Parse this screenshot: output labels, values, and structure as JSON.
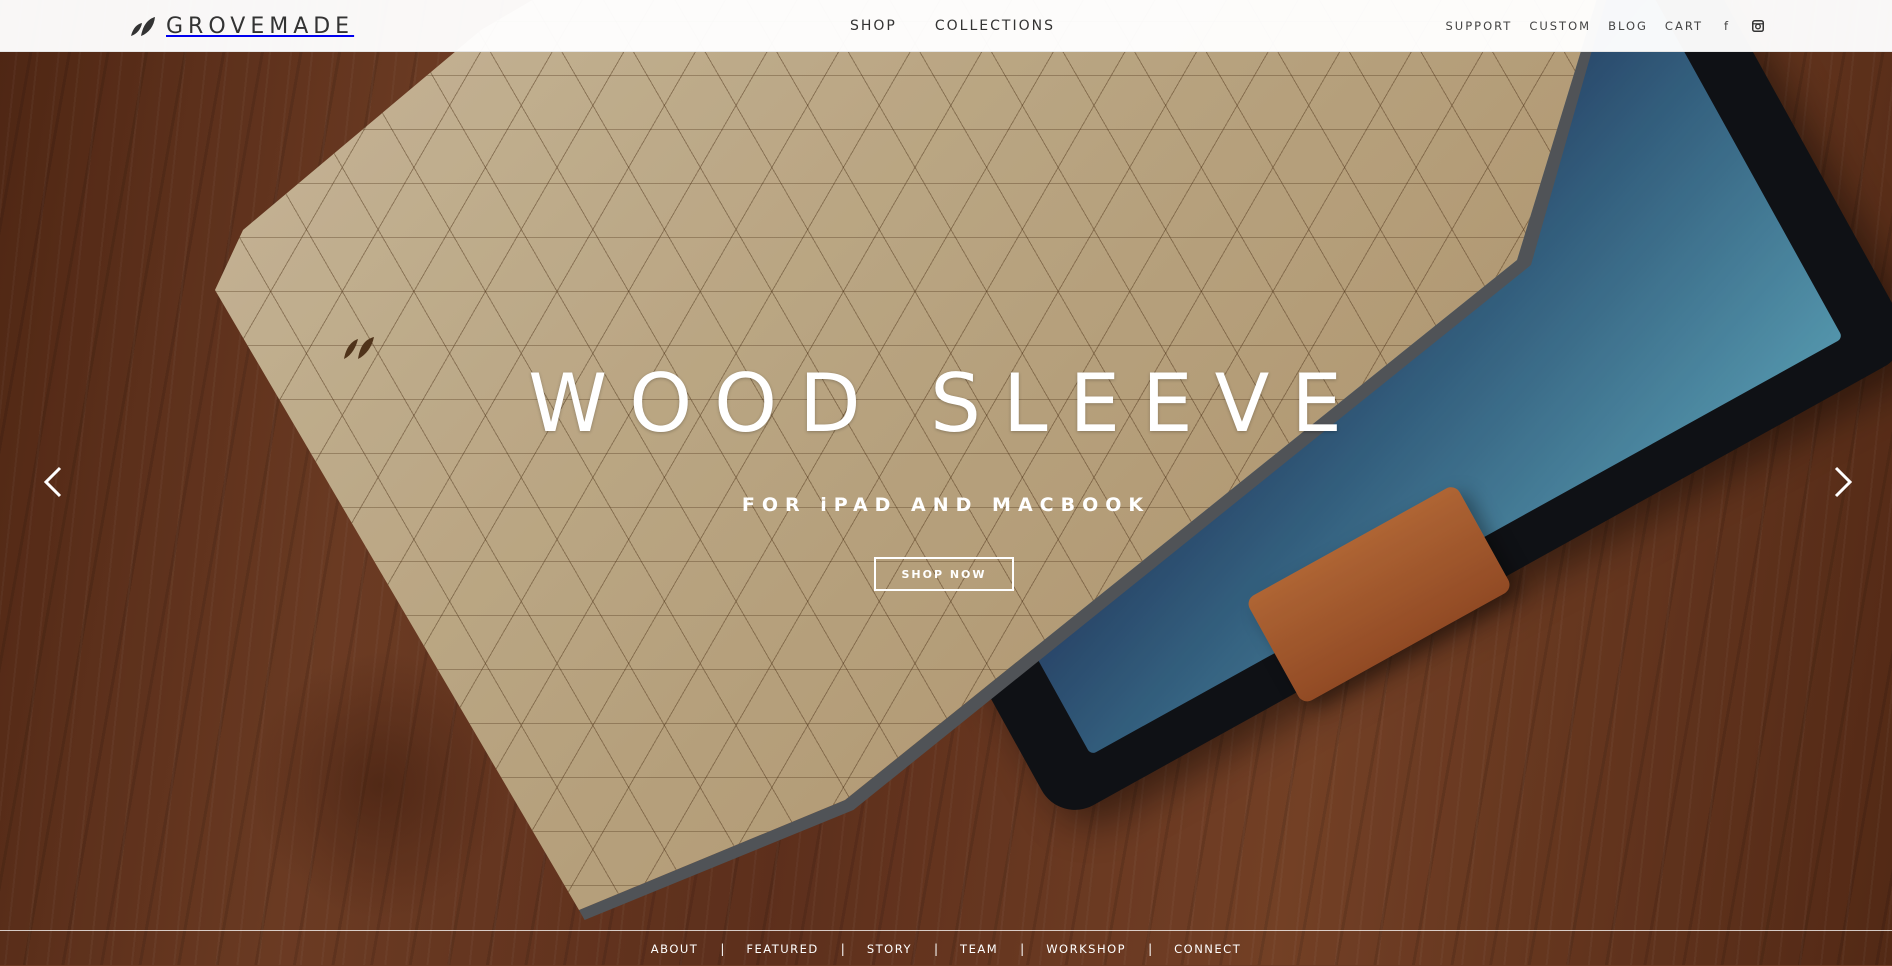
{
  "brand": {
    "name": "GROVEMADE",
    "logo_icon": "leaf-logo-icon"
  },
  "main_nav": [
    {
      "label": "SHOP"
    },
    {
      "label": "COLLECTIONS"
    }
  ],
  "util_nav": [
    {
      "label": "SUPPORT"
    },
    {
      "label": "CUSTOM"
    },
    {
      "label": "BLOG"
    },
    {
      "label": "CART"
    }
  ],
  "social": [
    {
      "icon": "facebook-icon",
      "glyph": "f"
    },
    {
      "icon": "instagram-icon",
      "glyph": "◙"
    }
  ],
  "hero": {
    "title": "WOOD SLEEVE",
    "subtitle": "FOR iPAD AND MACBOOK",
    "cta_label": "SHOP NOW",
    "prev_icon": "chevron-left-icon",
    "next_icon": "chevron-right-icon"
  },
  "footer_nav": [
    {
      "label": "ABOUT"
    },
    {
      "label": "FEATURED"
    },
    {
      "label": "STORY"
    },
    {
      "label": "TEAM"
    },
    {
      "label": "WORKSHOP"
    },
    {
      "label": "CONNECT"
    }
  ],
  "footer_separator": "|",
  "colors": {
    "nav_bg": "#f7f7f7",
    "nav_text": "#333333",
    "hero_text": "#ffffff",
    "wood_table": "#6b3a22",
    "maple_sleeve": "#d3bc94"
  }
}
